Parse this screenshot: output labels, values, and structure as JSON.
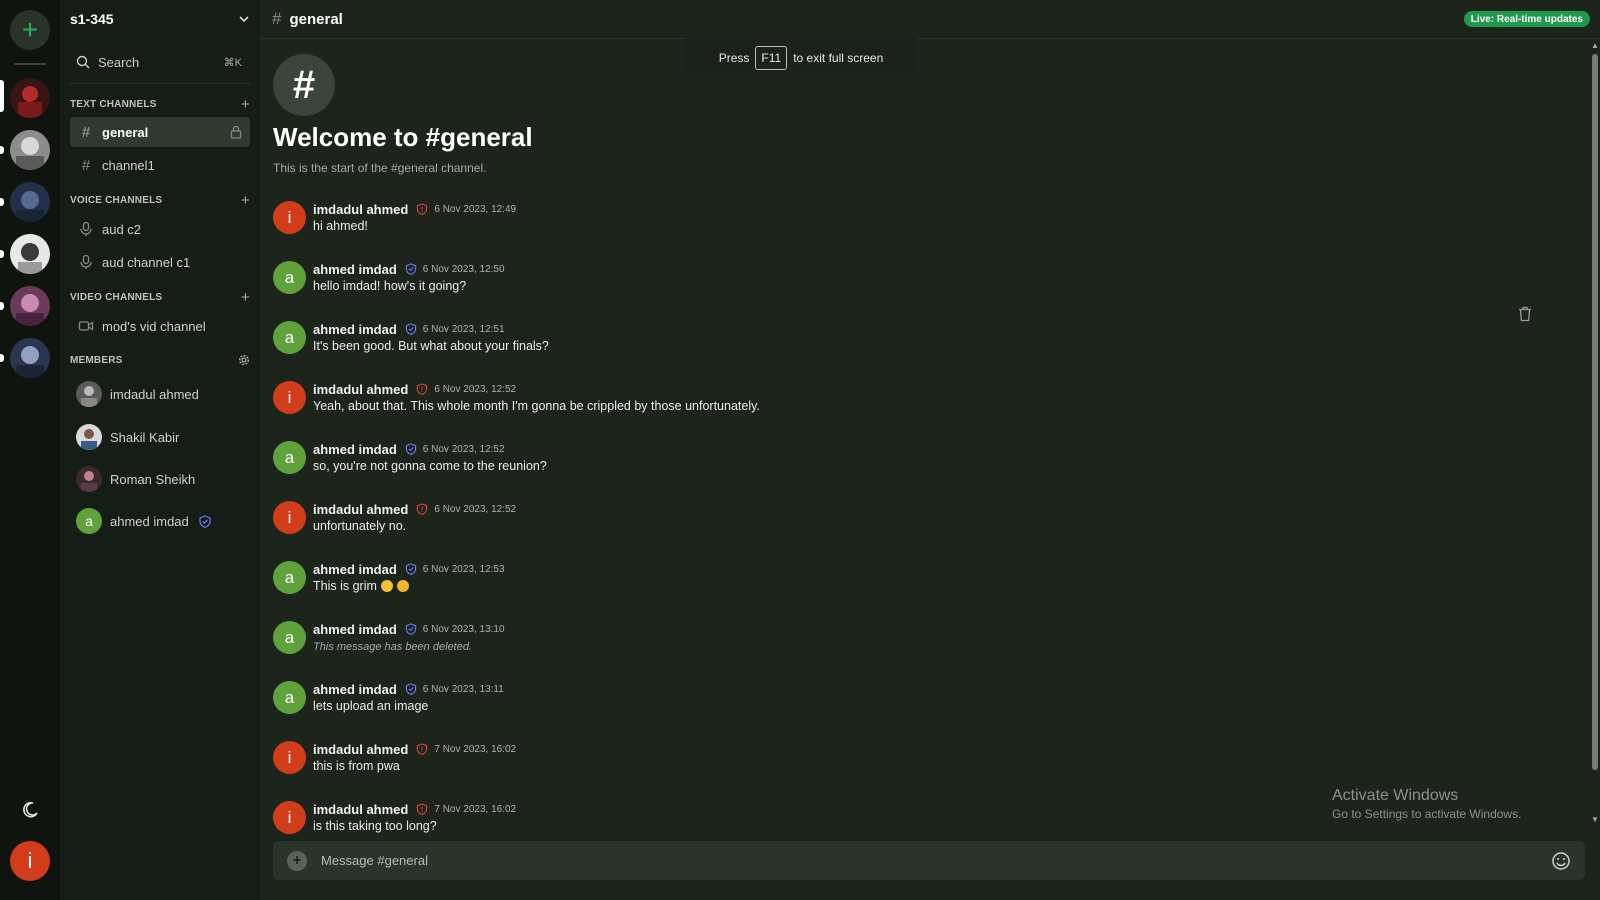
{
  "colors": {
    "accent_green": "#22b15a",
    "live_badge": "#1f9a4d",
    "avatar_imdadul": "#d13c1a",
    "avatar_ahmed": "#5fa23c",
    "admin_shield": "#e0443a",
    "mod_shield": "#6b7cff"
  },
  "server": {
    "name": "s1-345",
    "search_label": "Search",
    "search_shortcut": "⌘K"
  },
  "sections": {
    "text": "TEXT CHANNELS",
    "voice": "VOICE CHANNELS",
    "video": "VIDEO CHANNELS",
    "members": "MEMBERS"
  },
  "text_channels": [
    {
      "name": "general"
    },
    {
      "name": "channel1"
    }
  ],
  "voice_channels": [
    {
      "name": "aud c2"
    },
    {
      "name": "aud channel c1"
    }
  ],
  "video_channels": [
    {
      "name": "mod's vid channel"
    }
  ],
  "members": [
    {
      "name": "imdadul ahmed"
    },
    {
      "name": "Shakil Kabir"
    },
    {
      "name": "Roman Sheikh"
    },
    {
      "name": "ahmed imdad",
      "initial": "a"
    }
  ],
  "user": {
    "initial": "i"
  },
  "header": {
    "channel": "general",
    "live": "Live: Real-time updates"
  },
  "toast": {
    "before": "Press",
    "key": "F11",
    "after": "to exit full screen"
  },
  "welcome": {
    "title": "Welcome to #general",
    "subtitle": "This is the start of the #general channel."
  },
  "messages": [
    {
      "initial": "i",
      "author": "imdadul ahmed",
      "role": "admin",
      "time": "6 Nov 2023, 12:49",
      "text": "hi ahmed!"
    },
    {
      "initial": "a",
      "author": "ahmed imdad",
      "role": "mod",
      "time": "6 Nov 2023, 12:50",
      "text": "hello imdad! how's it going?"
    },
    {
      "initial": "a",
      "author": "ahmed imdad",
      "role": "mod",
      "time": "6 Nov 2023, 12:51",
      "text": "It's been good. But what about your finals?"
    },
    {
      "initial": "i",
      "author": "imdadul ahmed",
      "role": "admin",
      "time": "6 Nov 2023, 12:52",
      "text": "Yeah, about that. This whole month I'm gonna be crippled by those unfortunately."
    },
    {
      "initial": "a",
      "author": "ahmed imdad",
      "role": "mod",
      "time": "6 Nov 2023, 12:52",
      "text": "so, you're not gonna come to the reunion?"
    },
    {
      "initial": "i",
      "author": "imdadul ahmed",
      "role": "admin",
      "time": "6 Nov 2023, 12:52",
      "text": "unfortunately no."
    },
    {
      "initial": "a",
      "author": "ahmed imdad",
      "role": "mod",
      "time": "6 Nov 2023, 12:53",
      "text": "This is grim"
    },
    {
      "initial": "a",
      "author": "ahmed imdad",
      "role": "mod",
      "time": "6 Nov 2023, 13:10",
      "text": "This message has been deleted."
    },
    {
      "initial": "a",
      "author": "ahmed imdad",
      "role": "mod",
      "time": "6 Nov 2023, 13:11",
      "text": "lets upload an image"
    },
    {
      "initial": "i",
      "author": "imdadul ahmed",
      "role": "admin",
      "time": "7 Nov 2023, 16:02",
      "text": "this is from pwa"
    },
    {
      "initial": "i",
      "author": "imdadul ahmed",
      "role": "admin",
      "time": "7 Nov 2023, 16:02",
      "text": "is this taking too long?"
    }
  ],
  "composer": {
    "placeholder": "Message #general"
  },
  "watermark": {
    "title": "Activate Windows",
    "subtitle": "Go to Settings to activate Windows."
  }
}
